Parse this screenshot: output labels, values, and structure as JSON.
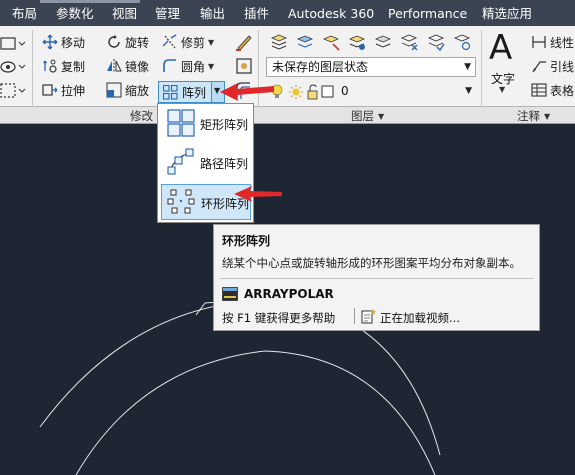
{
  "menubar": {
    "items": [
      "布局",
      "参数化",
      "视图",
      "管理",
      "输出",
      "插件",
      "Autodesk 360",
      "Performance",
      "精选应用"
    ]
  },
  "modify_panel": {
    "title": "修改",
    "move": "移动",
    "rotate": "旋转",
    "trim": "修剪",
    "copy": "复制",
    "mirror": "镜像",
    "fillet": "圆角",
    "stretch": "拉伸",
    "scale": "缩放",
    "array": "阵列"
  },
  "layers_panel": {
    "title": "图层",
    "layer_state": "未保存的图层状态",
    "current_layer": "0"
  },
  "annotation_panel": {
    "title": "注释",
    "text": "文字",
    "linear": "线性",
    "leader": "引线",
    "table": "表格"
  },
  "array_menu": {
    "items": [
      "矩形阵列",
      "路径阵列",
      "环形阵列"
    ],
    "active_index": 2
  },
  "tooltip": {
    "title": "环形阵列",
    "description": "绕某个中心点或旋转轴形成的环形图案平均分布对象副本。",
    "command": "ARRAYPOLAR",
    "help": "按 F1 键获得更多帮助",
    "video": "正在加载视频..."
  },
  "colors": {
    "menubar_bg": "#3b4453",
    "ribbon_bg": "#f2f2f2",
    "canvas_bg": "#1f2633",
    "highlight": "#cfe7f9",
    "annotation_arrow": "#e0282a"
  }
}
